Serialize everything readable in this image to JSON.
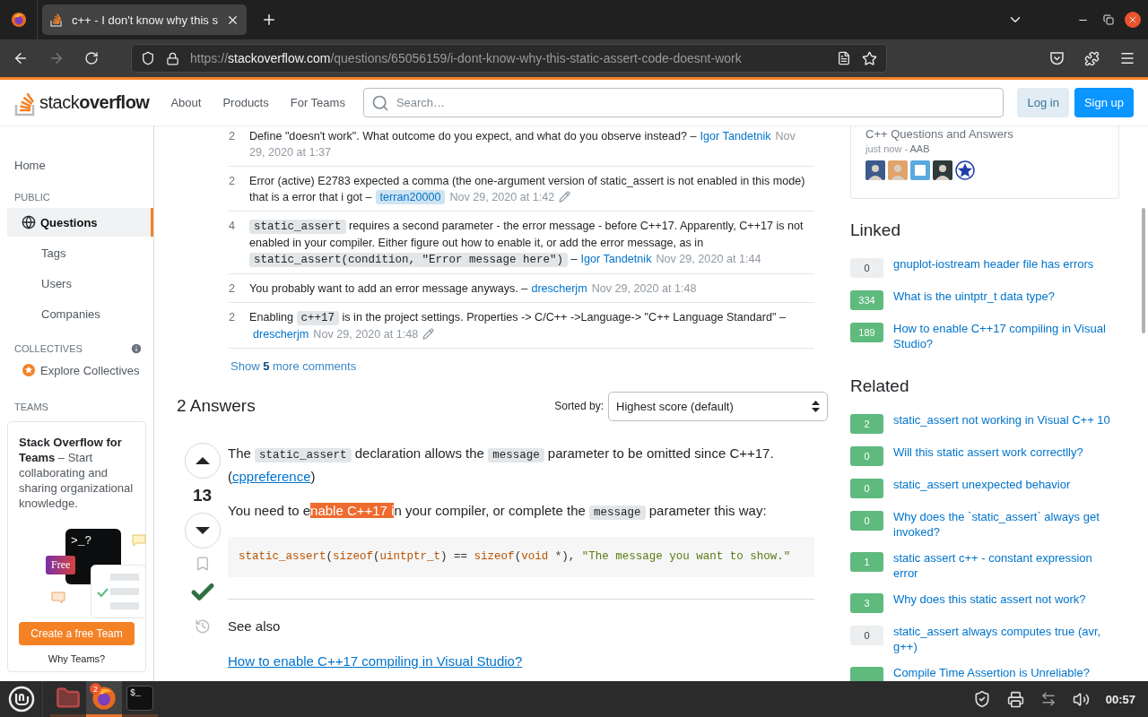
{
  "browser": {
    "tab_title": "c++ - I don't know why this s",
    "forward_disabled": true,
    "url": {
      "scheme": "https://",
      "host": "stackoverflow.com",
      "path": "/questions/65056159/i-dont-know-why-this-static-assert-code-doesnt-work"
    }
  },
  "header": {
    "logo": {
      "light": "stack",
      "bold": "overflow"
    },
    "nav": [
      "About",
      "Products",
      "For Teams"
    ],
    "search": {
      "placeholder": "Search…"
    },
    "buttons": [
      {
        "label": "Log in",
        "kind": "secondary"
      },
      {
        "label": "Sign up",
        "kind": "primary"
      }
    ]
  },
  "sidebar": {
    "home": {
      "label": "Home",
      "selected": false
    },
    "public": {
      "heading": "PUBLIC",
      "questions": {
        "label": "Questions",
        "selected": true
      },
      "items": [
        {
          "label": "Tags",
          "selected": false
        },
        {
          "label": "Users",
          "selected": false
        },
        {
          "label": "Companies",
          "selected": false
        }
      ]
    },
    "collectives": {
      "heading": "COLLECTIVES",
      "explore": "Explore Collectives"
    },
    "teams": {
      "heading": "TEAMS",
      "text": "**Stack Overflow for Teams** – Start collaborating and sharing organizational knowledge.",
      "prompt": ">_?",
      "badge": "Free",
      "button": "Create a free Team",
      "link": "Why Teams?"
    }
  },
  "comments": [
    {
      "score": "2",
      "parts": [
        {
          "kind": "text",
          "text": "Define \"doesn't work\". What outcome do you expect, and what do you observe instead? –"
        }
      ],
      "author": "Igor Tandetnik",
      "author_is_op": false,
      "date": "Nov 29, 2020 at 1:37",
      "edited": false
    },
    {
      "score": "2",
      "parts": [
        {
          "kind": "text",
          "text": "Error (active) E2783 expected a comma (the one-argument version of static_assert is not enabled in this mode) that is a error that i got –"
        }
      ],
      "author": "terran20000",
      "author_is_op": true,
      "date": "Nov 29, 2020 at 1:42",
      "edited": true
    },
    {
      "score": "4",
      "parts": [
        {
          "kind": "code",
          "text": "static_assert"
        },
        {
          "kind": "text",
          "text": " requires a second parameter - the error message - before C++17. Apparently, C++17 is not enabled in your compiler. Either figure out how to enable it, or add the error message, as in "
        },
        {
          "kind": "code",
          "text": "static_assert(condition, \"Error message here\")"
        },
        {
          "kind": "text",
          "text": " –"
        }
      ],
      "author": "Igor Tandetnik",
      "author_is_op": false,
      "date": "Nov 29, 2020 at 1:44",
      "edited": false
    },
    {
      "score": "2",
      "parts": [
        {
          "kind": "text",
          "text": "You probably want to add an error message anyways. –"
        }
      ],
      "author": "drescherjm",
      "author_is_op": false,
      "date": "Nov 29, 2020 at 1:48",
      "edited": false
    },
    {
      "score": "2",
      "parts": [
        {
          "kind": "text",
          "text": "Enabling "
        },
        {
          "kind": "code",
          "text": "c++17"
        },
        {
          "kind": "text",
          "text": " is in the project settings. Properties -> C/C++ ->Language-> \"C++ Language Standard\" –"
        }
      ],
      "author": "drescherjm",
      "author_is_op": false,
      "date": "Nov 29, 2020 at 1:48",
      "edited": true
    }
  ],
  "show_more": "Show **5** more comments",
  "answers": {
    "heading": "2 Answers",
    "sort_label": "Sorted by:",
    "sort_value": "Highest score (default)"
  },
  "answer": {
    "score": "13",
    "accepted": true,
    "bookmarked": false,
    "paragraphs": [
      [
        {
          "kind": "text",
          "text": "The "
        },
        {
          "kind": "code",
          "text": "static_assert"
        },
        {
          "kind": "text",
          "text": " declaration allows the "
        },
        {
          "kind": "code",
          "text": "message"
        },
        {
          "kind": "text",
          "text": " parameter to be omitted since C++17. ("
        },
        {
          "kind": "link",
          "text": "cppreference"
        },
        {
          "kind": "text",
          "text": ")"
        }
      ],
      [
        {
          "kind": "text",
          "text": "You need to e"
        },
        {
          "kind": "selected",
          "text": "nable C++17 i"
        },
        {
          "kind": "text",
          "text": "n your compiler, or complete the "
        },
        {
          "kind": "code",
          "text": "message"
        },
        {
          "kind": "text",
          "text": " parameter this way:"
        }
      ]
    ],
    "code": [
      {
        "kind": "name",
        "text": "static_assert"
      },
      {
        "kind": "plain",
        "text": "("
      },
      {
        "kind": "name",
        "text": "sizeof"
      },
      {
        "kind": "plain",
        "text": "("
      },
      {
        "kind": "name",
        "text": "uintptr_t"
      },
      {
        "kind": "plain",
        "text": ") == "
      },
      {
        "kind": "name",
        "text": "sizeof"
      },
      {
        "kind": "plain",
        "text": "("
      },
      {
        "kind": "name",
        "text": "void"
      },
      {
        "kind": "plain",
        "text": " *), "
      },
      {
        "kind": "string",
        "text": "\"The message you want to show.\""
      }
    ],
    "see_also": {
      "heading": "See also",
      "link": "How to enable C++17 compiling in Visual Studio?"
    }
  },
  "community": {
    "title": "C++ Questions and Answers",
    "time": "just now -",
    "author": "AAB",
    "avatars": [
      {
        "kind": "figure",
        "color": "#3b5b8a"
      },
      {
        "kind": "figure",
        "color": "#e0a46a"
      },
      {
        "kind": "frame",
        "color": "#5aa9e0"
      },
      {
        "kind": "figure",
        "color": "#2e3b3a"
      },
      {
        "kind": "star",
        "color": "#1f3fa8"
      }
    ]
  },
  "linked": {
    "heading": "Linked",
    "items": [
      {
        "score": "0",
        "answered": false,
        "title": "gnuplot-iostream header file has errors"
      },
      {
        "score": "334",
        "answered": true,
        "title": "What is the uintptr_t data type?"
      },
      {
        "score": "189",
        "answered": true,
        "title": "How to enable C++17 compiling in Visual Studio?"
      }
    ]
  },
  "related": {
    "heading": "Related",
    "items": [
      {
        "score": "2",
        "answered": true,
        "title": "static_assert not working in Visual C++ 10"
      },
      {
        "score": "0",
        "answered": true,
        "title": "Will this static assert work correctlly?"
      },
      {
        "score": "0",
        "answered": true,
        "title": "static_assert unexpected behavior"
      },
      {
        "score": "0",
        "answered": true,
        "title": "Why does the `static_assert` always get invoked?"
      },
      {
        "score": "1",
        "answered": true,
        "title": "static assert c++ - constant expression error"
      },
      {
        "score": "3",
        "answered": true,
        "title": "Why does this static assert not work?"
      },
      {
        "score": "0",
        "answered": false,
        "title": "static_assert always computes true (avr, g++)"
      },
      {
        "answered": true,
        "title": "Compile Time Assertion is Unreliable?"
      }
    ]
  },
  "taskbar": {
    "apps": [
      {
        "kind": "files",
        "active": false
      },
      {
        "kind": "firefox",
        "active": true,
        "badge": "2"
      },
      {
        "kind": "terminal",
        "active": false,
        "glyph": "$_"
      }
    ],
    "clock": "00:57"
  }
}
